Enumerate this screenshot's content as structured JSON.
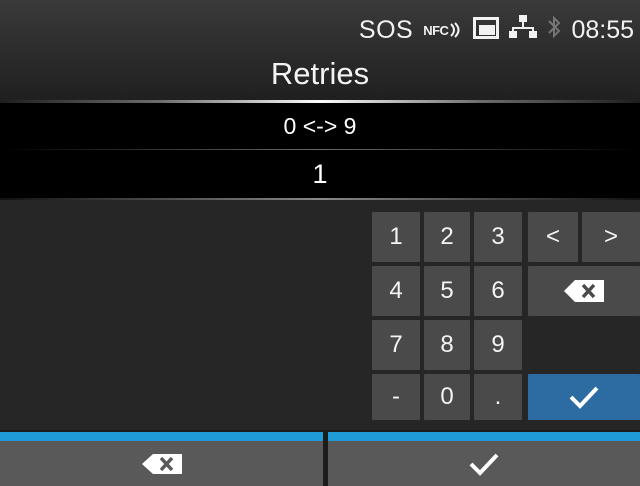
{
  "status_bar": {
    "sos": "SOS",
    "nfc": "NFC",
    "icons": [
      "nfc-icon",
      "sd-card-icon",
      "network-icon",
      "bluetooth-icon"
    ],
    "time": "08:55"
  },
  "title": "Retries",
  "range": "0 <-> 9",
  "value": "1",
  "keypad": {
    "keys": [
      "1",
      "2",
      "3",
      "<",
      ">",
      "4",
      "5",
      "6",
      "backspace",
      "7",
      "8",
      "9",
      "-",
      "0",
      ".",
      "enter"
    ],
    "labels": {
      "k1": "1",
      "k2": "2",
      "k3": "3",
      "left": "<",
      "right": ">",
      "k4": "4",
      "k5": "5",
      "k6": "6",
      "k7": "7",
      "k8": "8",
      "k9": "9",
      "minus": "-",
      "k0": "0",
      "dot": "."
    }
  },
  "bottom_bar": {
    "left_icon": "backspace-icon",
    "right_icon": "checkmark-icon"
  },
  "colors": {
    "accent_bar": "#1f9bd7",
    "enter_key": "#2c6ca3",
    "key": "#4a4a4a",
    "bottom_button": "#595959"
  }
}
